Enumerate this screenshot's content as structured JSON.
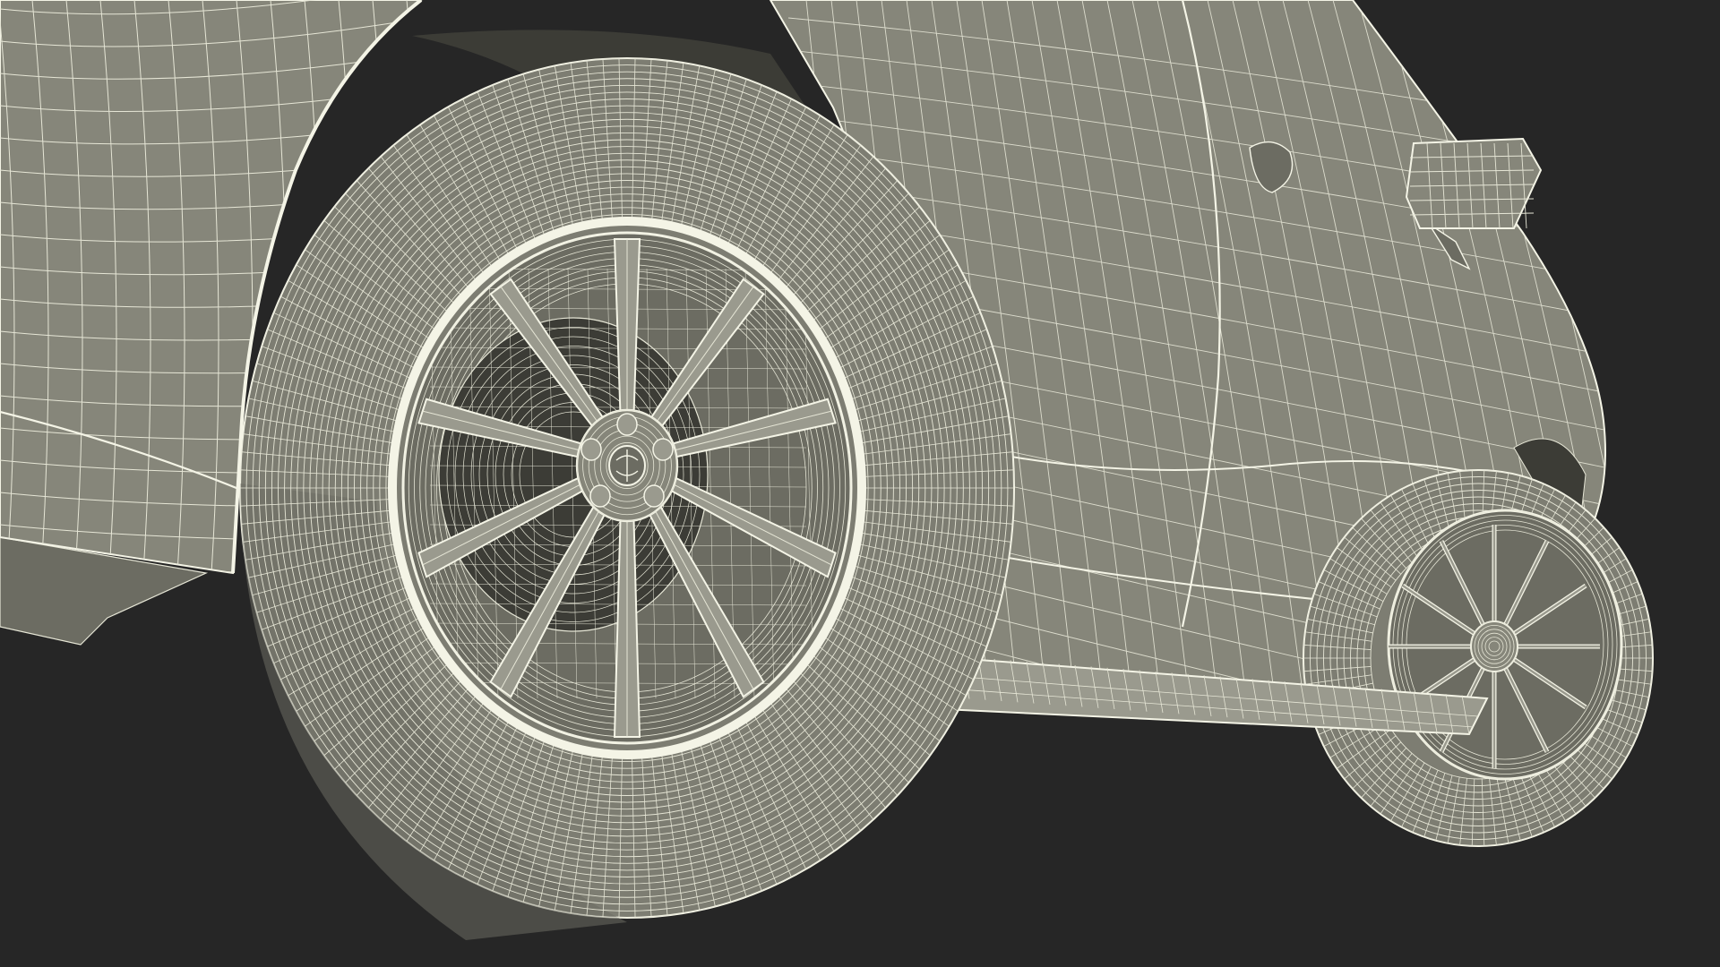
{
  "scene": {
    "subject": "car-wireframe-render",
    "colors": {
      "background": "#262626",
      "surface": "#86867a",
      "surface_dark": "#6c6c62",
      "surface_light": "#9a9a8e",
      "tire": "#7d7d72",
      "wire": "#e6e6d6",
      "wire_bright": "#f4f4e6",
      "shadow": "#3c3c36"
    }
  }
}
